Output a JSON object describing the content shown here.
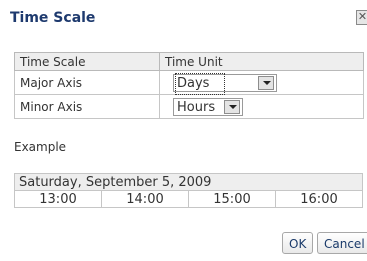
{
  "dialog": {
    "title": "Time Scale",
    "close_icon": "close-icon"
  },
  "axis_table": {
    "headers": [
      "Time Scale",
      "Time Unit"
    ],
    "rows": [
      {
        "label": "Major Axis",
        "unit": "Days"
      },
      {
        "label": "Minor Axis",
        "unit": "Hours"
      }
    ]
  },
  "example": {
    "label": "Example",
    "date": "Saturday, September 5, 2009",
    "hours": [
      "13:00",
      "14:00",
      "15:00",
      "16:00"
    ]
  },
  "buttons": {
    "ok": "OK",
    "cancel": "Cancel"
  }
}
